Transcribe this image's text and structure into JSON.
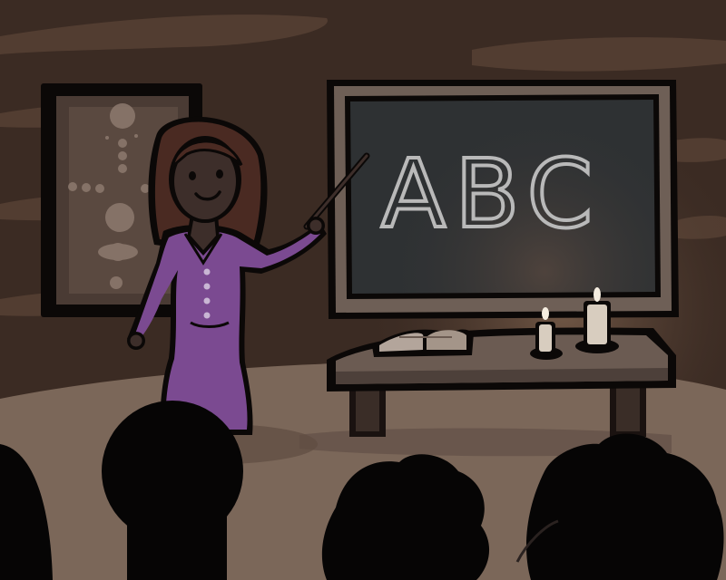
{
  "scene": {
    "chalkboard": {
      "text": "ABC"
    },
    "colors": {
      "wall_dark": "#3a2a22",
      "wall_light": "#5a4438",
      "floor": "#7a6658",
      "chalkboard": "#2e3133",
      "frame": "#6d5e55",
      "dress": "#7b4a91",
      "hair": "#4a2a22",
      "skin": "#3d2e2a",
      "candle_flame": "#f5ede0",
      "silhouette": "#050404"
    },
    "icons": [
      "planet-poster-icon",
      "teacher-icon",
      "pointer-stick-icon",
      "open-book-icon",
      "candle-icon",
      "audience-silhouette-icon"
    ]
  }
}
